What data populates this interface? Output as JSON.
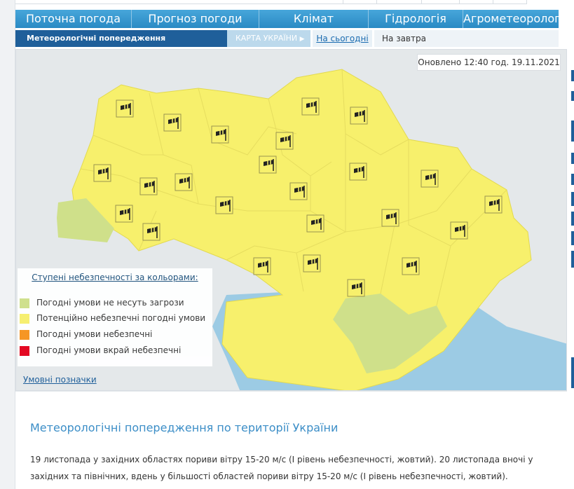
{
  "nav": {
    "main": [
      {
        "label": "Поточна погода"
      },
      {
        "label": "Прогноз погоди"
      },
      {
        "label": "Клімат"
      },
      {
        "label": "Гідрологія"
      },
      {
        "label": "Агрометеорологія"
      }
    ],
    "sub": {
      "active": "Метеорологічні попередження",
      "map": "КАРТА УКРАЇНИ",
      "today": "На сьогодні",
      "tomorrow": "На завтра"
    }
  },
  "map": {
    "updated": "Оновлено 12:40 год. 19.11.2021",
    "icon_name": "windsock-icon",
    "colors": {
      "no_threat": "#cfe08a",
      "potential": "#f7f06c",
      "dangerous": "#f7931e",
      "extreme": "#e3001b",
      "sea": "#9ccbe4",
      "land_outside": "#e4e8ea"
    }
  },
  "legend": {
    "title": "Ступені небезпечності за кольорами:",
    "items": [
      {
        "label": "Погодні умови не несуть загрози",
        "color": "#cfe08a"
      },
      {
        "label": "Потенційно небезпечні погодні умови",
        "color": "#f7f06c"
      },
      {
        "label": "Погодні умови небезпечні",
        "color": "#f7931e"
      },
      {
        "label": "Погодні умови вкрай небезпечні",
        "color": "#e3001b"
      }
    ],
    "symbols_link": "Умовні позначки"
  },
  "article": {
    "title": "Метеорологічні попередження по території України",
    "text": "19 листопада у західних областях пориви вітру 15-20 м/с (І рівень небезпечності, жовтий). 20 листопада вночі у західних та північних, вдень у більшості областей пориви вітру 15-20 м/с (І рівень небезпечності, жовтий)."
  }
}
